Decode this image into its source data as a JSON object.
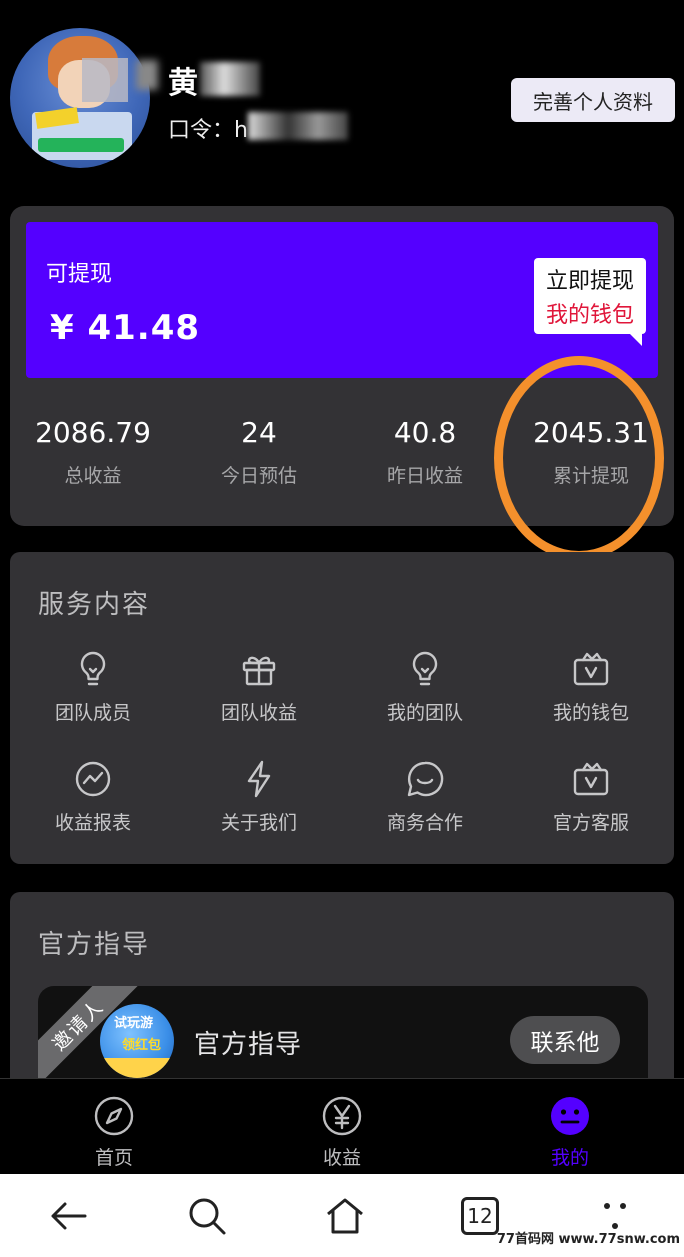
{
  "profile": {
    "name": "黄",
    "code_label": "口令：h",
    "edit_button": "完善个人资料"
  },
  "wallet": {
    "withdrawable_label": "可提现",
    "withdrawable_amount": "¥ 41.48",
    "bubble_line1": "立即提现",
    "bubble_line2": "我的钱包",
    "stats": [
      {
        "value": "2086.79",
        "label": "总收益"
      },
      {
        "value": "24",
        "label": "今日预估"
      },
      {
        "value": "40.8",
        "label": "昨日收益"
      },
      {
        "value": "2045.31",
        "label": "累计提现"
      }
    ],
    "accent_color": "#5400ff",
    "highlight_color": "#f4902c"
  },
  "services": {
    "title": "服务内容",
    "items": [
      {
        "label": "团队成员",
        "icon": "lightbulb-icon"
      },
      {
        "label": "团队收益",
        "icon": "gift-icon"
      },
      {
        "label": "我的团队",
        "icon": "lightbulb-icon"
      },
      {
        "label": "我的钱包",
        "icon": "wallet-icon"
      },
      {
        "label": "收益报表",
        "icon": "chart-circle-icon"
      },
      {
        "label": "关于我们",
        "icon": "lightning-icon"
      },
      {
        "label": "商务合作",
        "icon": "chat-bubble-icon"
      },
      {
        "label": "官方客服",
        "icon": "wallet-icon"
      }
    ]
  },
  "guide": {
    "title": "官方指导",
    "ribbon": "邀请人",
    "promo_line1": "试玩游",
    "promo_line2": "领红包",
    "label": "官方指导",
    "contact_button": "联系他"
  },
  "tabbar": {
    "items": [
      {
        "label": "首页",
        "icon": "compass-icon"
      },
      {
        "label": "收益",
        "icon": "yen-circle-icon"
      },
      {
        "label": "我的",
        "icon": "smiley-icon",
        "active": true
      }
    ]
  },
  "navbar": {
    "tab_count": "12",
    "watermark": "77首码网 www.77snw.com"
  }
}
